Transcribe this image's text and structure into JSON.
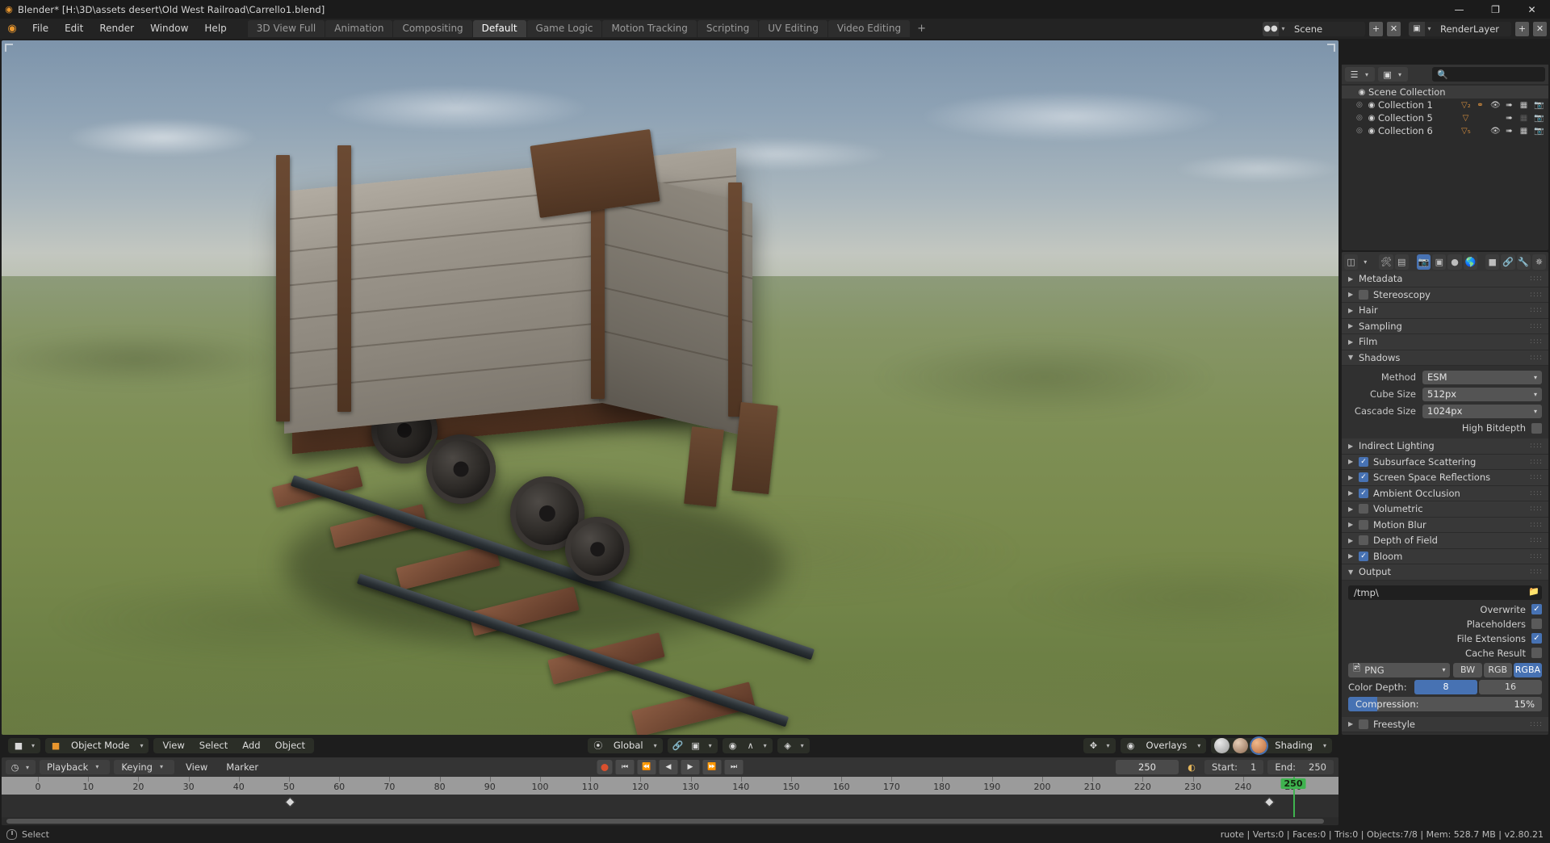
{
  "window": {
    "title": "Blender* [H:\\3D\\assets desert\\Old West Railroad\\Carrello1.blend]",
    "minimize": "—",
    "maximize": "❐",
    "close": "✕"
  },
  "menubar": {
    "logo_icon": "blender-logo-icon",
    "items": [
      "File",
      "Edit",
      "Render",
      "Window",
      "Help"
    ]
  },
  "workspaces": {
    "tabs": [
      "3D View Full",
      "Animation",
      "Compositing",
      "Default",
      "Game Logic",
      "Motion Tracking",
      "Scripting",
      "UV Editing",
      "Video Editing"
    ],
    "active": "Default",
    "add_label": "+"
  },
  "topbar_right": {
    "scene": {
      "icon": "scene-icon",
      "name": "Scene",
      "new": "+",
      "remove": "✕"
    },
    "viewlayer": {
      "icon": "renderlayer-icon",
      "name": "RenderLayer",
      "new": "+",
      "remove": "✕"
    }
  },
  "outliner": {
    "display_mode_icon": "outliner-view-layer-icon",
    "filter_icon": "renderlayer-icon",
    "search_icon": "search-icon",
    "search_placeholder": "",
    "root": {
      "label": "Scene Collection",
      "icon": "collection-icon"
    },
    "rows": [
      {
        "label": "Collection 1",
        "icon": "collection-icon",
        "expand": "⊕",
        "badges": [
          "▽₂",
          "🔑"
        ],
        "eye": true,
        "cursor": true,
        "grid": true,
        "camera": true
      },
      {
        "label": "Collection 5",
        "icon": "collection-icon",
        "expand": "⊕",
        "badges": [
          "▽"
        ],
        "eye": false,
        "cursor": true,
        "grid": false,
        "camera": false
      },
      {
        "label": "Collection 6",
        "icon": "collection-icon",
        "expand": "⊕",
        "badges": [
          "▽₅"
        ],
        "eye": true,
        "cursor": true,
        "grid": true,
        "camera": true
      }
    ]
  },
  "properties": {
    "editor_icon": "properties-editor-icon",
    "tabs": [
      {
        "name": "tool-tab",
        "glyph": "🛠",
        "active": false
      },
      {
        "name": "render-layers-tab",
        "glyph": "▤",
        "active": false
      },
      {
        "name": "render-tab",
        "glyph": "📷",
        "active": true
      },
      {
        "name": "output-tab",
        "glyph": "🖼",
        "active": false
      },
      {
        "name": "scene-tab",
        "glyph": "⚙",
        "active": false
      },
      {
        "name": "world-tab",
        "glyph": "🌐",
        "active": false
      },
      {
        "name": "object-tab",
        "glyph": "■",
        "active": false
      },
      {
        "name": "constraints-tab",
        "glyph": "🔗",
        "active": false
      },
      {
        "name": "modifiers-tab",
        "glyph": "🔧",
        "active": false
      },
      {
        "name": "particles-tab",
        "glyph": "✵",
        "active": false
      }
    ],
    "panels": [
      {
        "label": "Metadata",
        "open": false,
        "checkbox": null
      },
      {
        "label": "Stereoscopy",
        "open": false,
        "checkbox": false
      },
      {
        "label": "Hair",
        "open": false,
        "checkbox": null
      },
      {
        "label": "Sampling",
        "open": false,
        "checkbox": null
      },
      {
        "label": "Film",
        "open": false,
        "checkbox": null
      },
      {
        "label": "Shadows",
        "open": true,
        "checkbox": null
      }
    ],
    "shadows": {
      "method_label": "Method",
      "method_value": "ESM",
      "cube_label": "Cube Size",
      "cube_value": "512px",
      "cascade_label": "Cascade Size",
      "cascade_value": "1024px",
      "bitdepth_label": "High Bitdepth",
      "bitdepth_checked": false
    },
    "effects": [
      {
        "label": "Indirect Lighting",
        "checkbox": null
      },
      {
        "label": "Subsurface Scattering",
        "checkbox": true
      },
      {
        "label": "Screen Space Reflections",
        "checkbox": true
      },
      {
        "label": "Ambient Occlusion",
        "checkbox": true
      },
      {
        "label": "Volumetric",
        "checkbox": false
      },
      {
        "label": "Motion Blur",
        "checkbox": false
      },
      {
        "label": "Depth of Field",
        "checkbox": false
      },
      {
        "label": "Bloom",
        "checkbox": true
      }
    ],
    "output": {
      "label": "Output",
      "path_value": "/tmp\\",
      "file_browse_icon": "folder-icon",
      "toggles": [
        {
          "label": "Overwrite",
          "checked": true
        },
        {
          "label": "Placeholders",
          "checked": false
        },
        {
          "label": "File Extensions",
          "checked": true
        },
        {
          "label": "Cache Result",
          "checked": false
        }
      ],
      "format": "PNG",
      "format_icon": "image-file-icon",
      "color_modes": [
        "BW",
        "RGB",
        "RGBA"
      ],
      "color_mode_active": "RGBA",
      "color_depth_label": "Color Depth:",
      "color_depths": [
        "8",
        "16"
      ],
      "color_depth_active": "8",
      "compression_label": "Compression:",
      "compression_value": "15%",
      "compression_percent": 15
    },
    "freestyle": {
      "label": "Freestyle",
      "checked": false
    }
  },
  "viewport": {
    "editor_icon": "editor-type-3dview-icon",
    "mode": "Object Mode",
    "mode_icon": "object-mode-icon",
    "menus": [
      "View",
      "Select",
      "Add",
      "Object"
    ],
    "transform_orientation": "Global",
    "orientation_icon": "orientation-icon",
    "snap_icon": "magnet-icon",
    "snap_target_icon": "snap-target-icon",
    "proportional_icon": "proportional-edit-icon",
    "falloff_icon": "falloff-curve-icon",
    "pivot_icon": "pivot-point-icon",
    "visibility_icon": "show-gizmo-icon",
    "overlays_icon": "overlays-icon",
    "overlays_label": "Overlays",
    "shading_label": "Shading",
    "shading_modes": [
      "solid-shading",
      "material-preview-shading",
      "rendered-shading"
    ],
    "shading_active": "rendered-shading"
  },
  "timeline": {
    "editor_icon": "editor-type-timeline-icon",
    "menus_dropdowns": [
      "Playback",
      "Keying"
    ],
    "menus_plain": [
      "View",
      "Marker"
    ],
    "record_icon": "record-button-icon",
    "transport": [
      "⏮",
      "⏪",
      "◀",
      "▶",
      "⏩",
      "⏭"
    ],
    "current_frame": "250",
    "frame_icon": "frame-icon",
    "start_label": "Start:",
    "start_value": "1",
    "end_label": "End:",
    "end_value": "250",
    "ruler_ticks": [
      "0",
      "10",
      "20",
      "30",
      "40",
      "50",
      "60",
      "70",
      "80",
      "90",
      "100",
      "110",
      "120",
      "130",
      "140",
      "150",
      "160",
      "170",
      "180",
      "190",
      "200",
      "210",
      "220",
      "230",
      "240",
      "250"
    ],
    "playhead_label": "250"
  },
  "statusbar": {
    "mouse_icon": "mouse-icon",
    "left_label": "Select",
    "right_label": "ruote | Verts:0 | Faces:0 | Tris:0 | Objects:7/8 | Mem: 528.7 MB | v2.80.21"
  },
  "colors": {
    "accent_blue": "#4772b3",
    "playhead_green": "#3fb34f",
    "record_red": "#d9502e",
    "orange": "#e8962e"
  }
}
